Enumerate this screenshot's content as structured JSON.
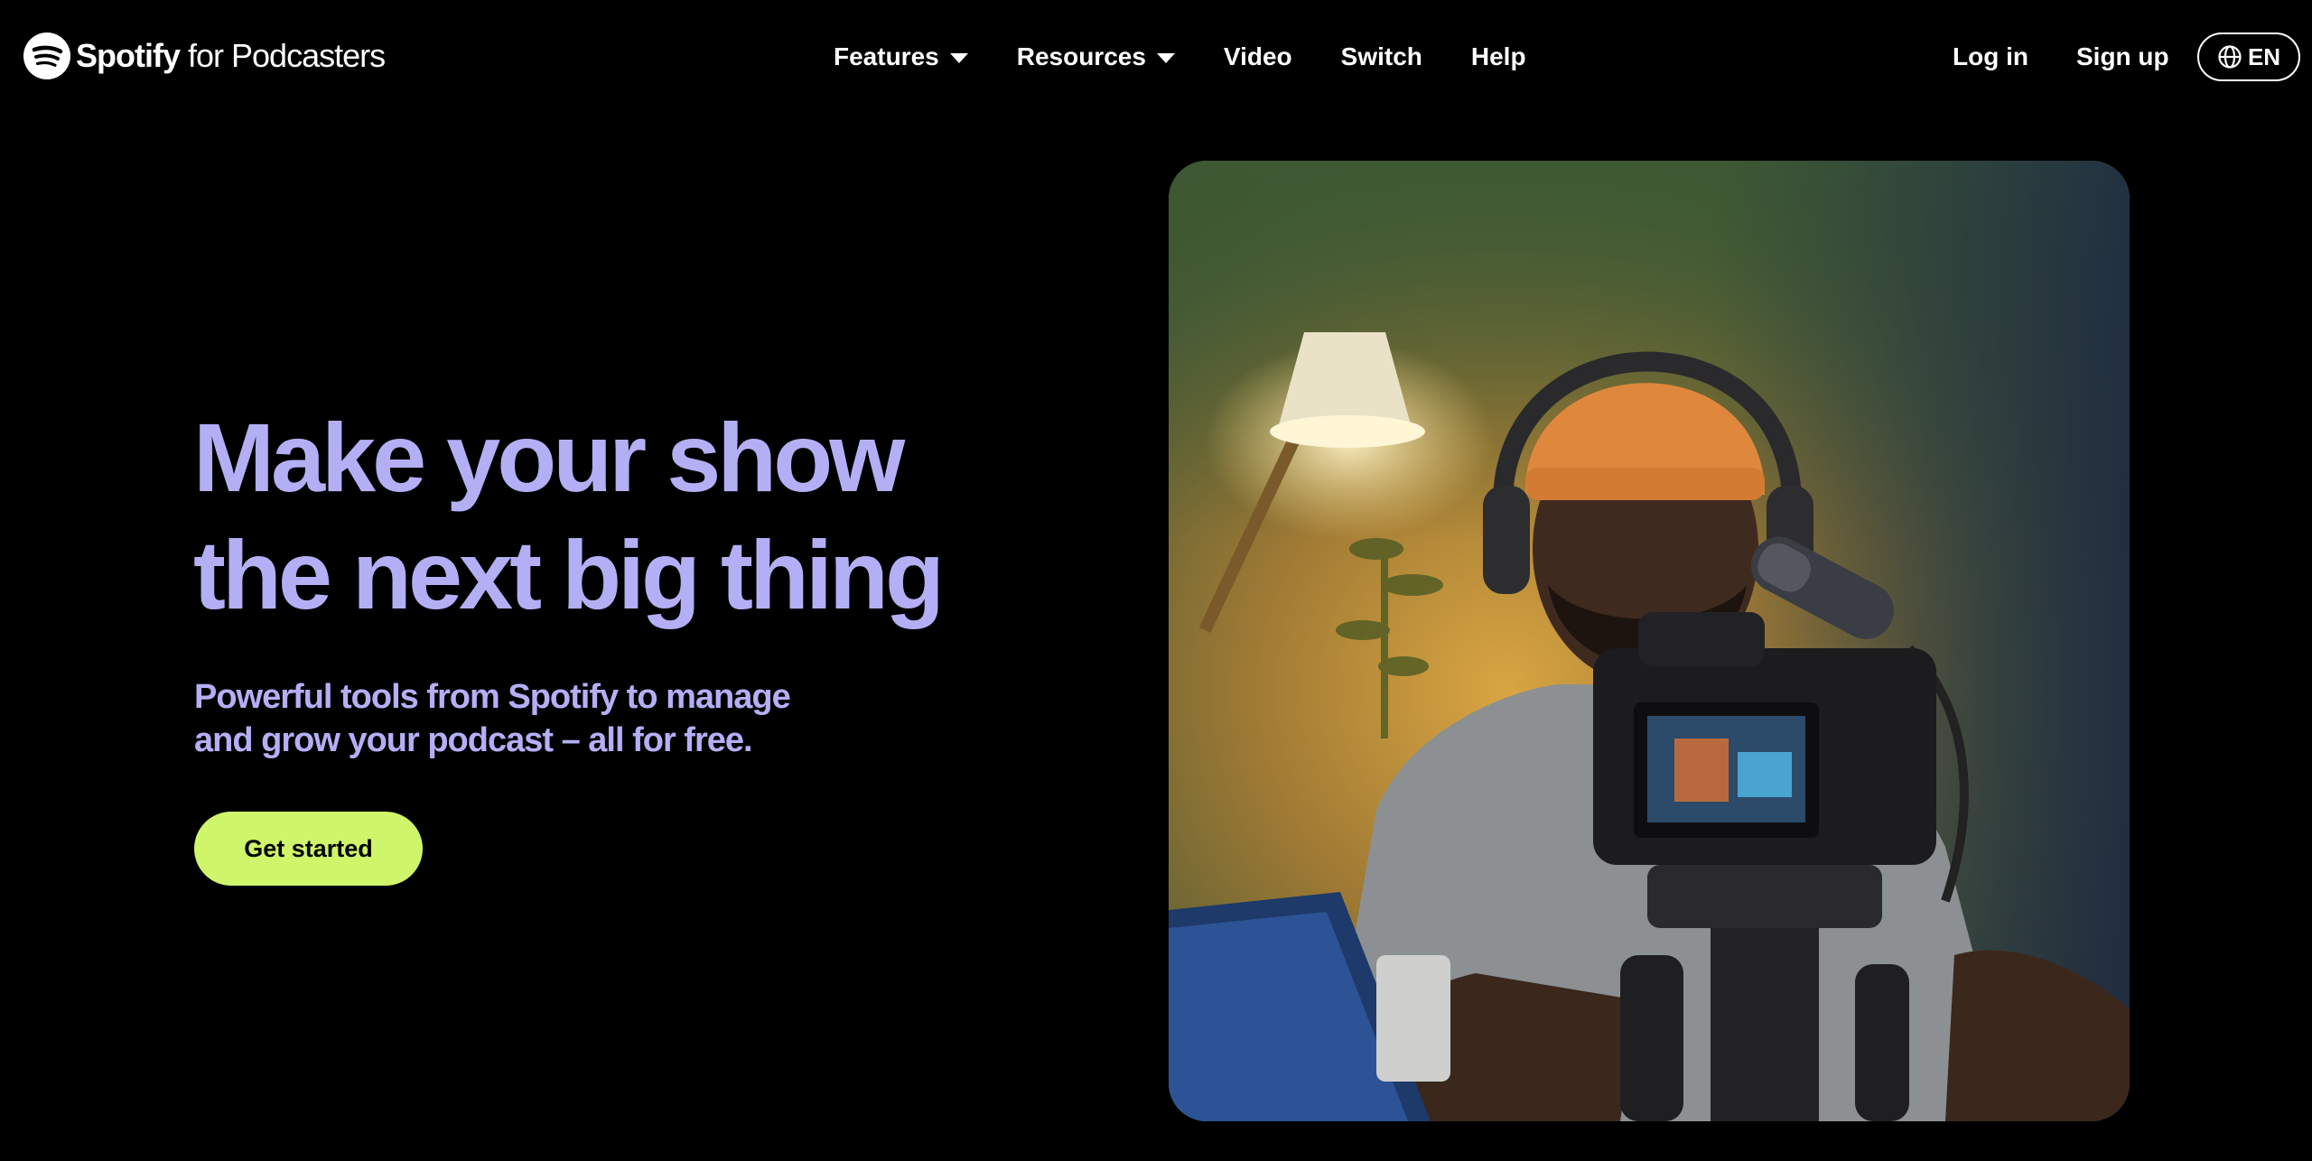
{
  "brand": {
    "name": "Spotify",
    "suffix": "for Podcasters",
    "logo_icon": "spotify-logo-icon"
  },
  "nav": {
    "items": [
      {
        "label": "Features",
        "has_dropdown": true
      },
      {
        "label": "Resources",
        "has_dropdown": true
      },
      {
        "label": "Video",
        "has_dropdown": false
      },
      {
        "label": "Switch",
        "has_dropdown": false
      },
      {
        "label": "Help",
        "has_dropdown": false
      }
    ]
  },
  "auth": {
    "login_label": "Log in",
    "signup_label": "Sign up"
  },
  "language": {
    "icon": "globe-icon",
    "label": "EN"
  },
  "hero": {
    "title_line1": "Make your show",
    "title_line2": "the next big thing",
    "subtitle_line1": "Powerful tools from Spotify to manage",
    "subtitle_line2": "and grow your podcast – all for free.",
    "cta_label": "Get started",
    "image_subject": "podcaster-with-headphones-and-camera"
  },
  "colors": {
    "background": "#000000",
    "accent_lavender": "#b4aff5",
    "cta_green": "#cff56a",
    "text": "#ffffff"
  }
}
